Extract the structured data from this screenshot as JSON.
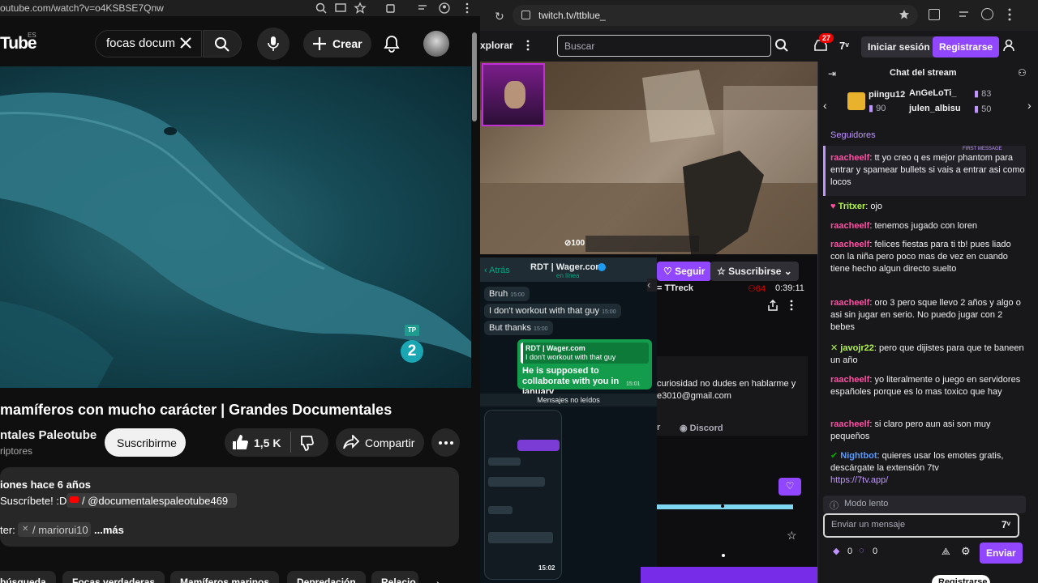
{
  "youtube": {
    "url": "outube.com/watch?v=o4KSBSE7Qnw",
    "logo": "Tube",
    "logo_region": "ES",
    "search_value": "focas docum",
    "create_label": "Crear",
    "video_badge": "2",
    "video_badge_top": "TP",
    "title": "mamíferos con mucho carácter | Grandes Documentales",
    "channel": "ntales Paleotube",
    "subscribers": "riptores",
    "subscribe_label": "Suscribirme",
    "likes": "1,5 K",
    "share_label": "Compartir",
    "desc_line1": "iones  hace 6 años",
    "desc_line2a": "Suscríbete! :D",
    "desc_line2b": "/ @documentalespaleotube469",
    "desc_line3a": "ter:",
    "desc_line3b": "/ mariorui10",
    "desc_more": "...más",
    "chips": [
      "búsqueda",
      "Focas verdaderas",
      "Mamíferos marinos",
      "Depredación",
      "Relacio"
    ]
  },
  "twitch": {
    "url": "twitch.tv/ttblue_",
    "explore": "xplorar",
    "search_placeholder": "Buscar",
    "notif_count": "27",
    "login_label": "Iniciar sesión",
    "signup_label": "Registrarse",
    "chat_title": "Chat del stream",
    "gifters": [
      {
        "name": "piingu12",
        "count": "90"
      },
      {
        "name": "AnGeLoTi_",
        "count": "83"
      },
      {
        "name": "julen_albisu",
        "count": "50"
      }
    ],
    "followers_label": "Seguidores",
    "first_message_tag": "FIRST MESSAGE",
    "messages": [
      {
        "user": "raacheelf",
        "text": "tt yo creo q es mejor phantom para entrar y spamear bullets si vais a entrar asi como locos",
        "color": "#ff4fa3"
      },
      {
        "user": "Tritxer",
        "text": "ojo",
        "color": "#b1f24b"
      },
      {
        "user": "raacheelf",
        "text": "tenemos jugado con loren",
        "color": "#ff4fa3"
      },
      {
        "user": "raacheelf",
        "text": "felices fiestas para ti tb! pues liado con la niña pero poco mas de vez en cuando tiene hecho algun directo suelto",
        "color": "#ff4fa3"
      },
      {
        "user": "raacheelf",
        "text": "oro 3 pero sque llevo 2 años y algo o asi sin jugar en serio. No puedo jugar con 2 bebes",
        "color": "#ff4fa3"
      },
      {
        "user": "javojr22",
        "text": "pero que dijistes para que te baneen un año",
        "color": "#b1f24b"
      },
      {
        "user": "raacheelf",
        "text": "yo literalmente o juego en servidores españoles porque es lo mas toxico que hay",
        "color": "#ff4fa3"
      },
      {
        "user": "raacheelf",
        "text": "si claro pero aun asi son muy pequeños",
        "color": "#ff4fa3"
      },
      {
        "user": "Nightbot",
        "text": "quieres usar los emotes gratis, descárgate la extensión 7tv",
        "color": "#5b99ff"
      }
    ],
    "nightbot_link": "https://7tv.app/",
    "slow_mode": "Modo lento",
    "send_placeholder": "Enviar un mensaje",
    "points_a": "0",
    "points_b": "0",
    "send_label": "Enviar",
    "follow_label": "Seguir",
    "subscribe_label": "Suscribirse",
    "streamer_tag": "= TTreck",
    "viewers": "64",
    "uptime": "0:39:11",
    "about_line1": "curiosidad no dudes en hablarme y",
    "about_line2": "e3010@gmail.com",
    "panel_r": "r",
    "discord_label": "Discord",
    "hud_money": "100",
    "bottom_register": "Registrarse"
  },
  "whatsapp": {
    "back": "Atrás",
    "contact": "RDT | Wager.com",
    "status": "en línea",
    "msgs": [
      {
        "text": "Bruh",
        "time": "15:00"
      },
      {
        "text": "I don't workout with that guy",
        "time": "15:00"
      },
      {
        "text": "But thanks",
        "time": "15:00"
      }
    ],
    "quote_name": "RDT | Wager.com",
    "quote_text": "I don't workout with that guy",
    "reply": "He is supposed to collaborate with you in january",
    "reply_time": "15:01",
    "unread": "Mensajes no leídos",
    "phone_time": "15:02"
  },
  "colors": {
    "twitch_purple": "#9147ff",
    "yt_bg": "#0f0f0f",
    "wa_green": "#129c4b"
  }
}
